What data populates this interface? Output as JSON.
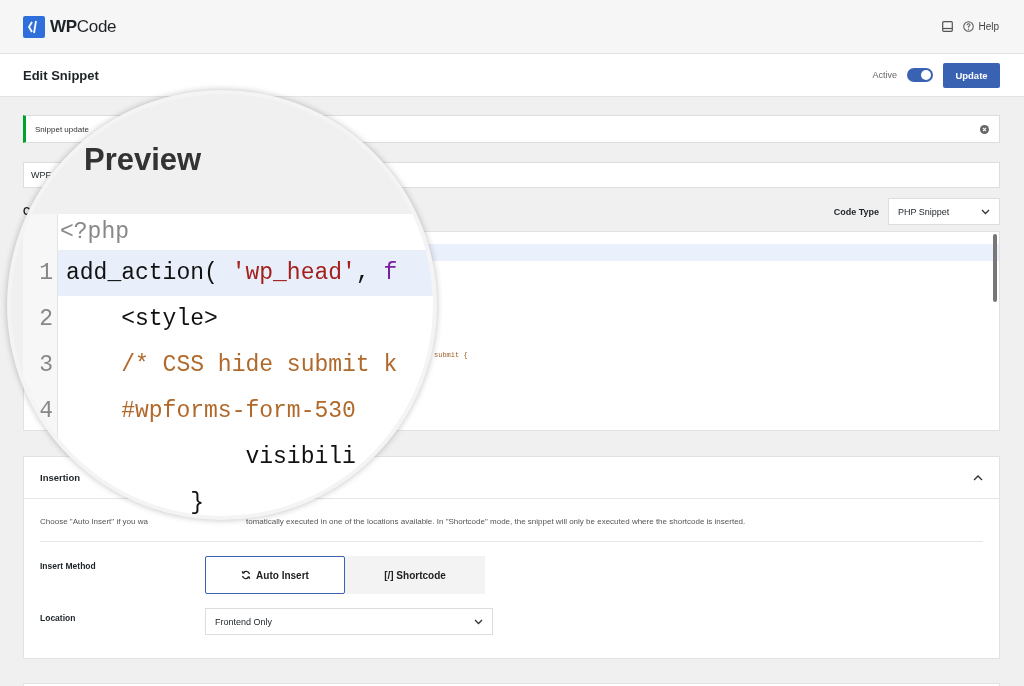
{
  "header": {
    "logo": "**WP**Code",
    "help": "Help"
  },
  "title_bar": {
    "title": "Edit Snippet",
    "active_label": "Active",
    "active_on": true,
    "update": "Update"
  },
  "notice": {
    "text": "Snippet update"
  },
  "snippet_title": {
    "value": "WPF"
  },
  "code": {
    "label": "C",
    "code_type_label": "Code Type",
    "code_type": "PHP Snippet",
    "visible_text": "submit {"
  },
  "magnifier": {
    "heading": "Preview",
    "lines": [
      {
        "kind": "open-tag",
        "tokens": [
          {
            "kind": "tag",
            "text": "<?php"
          }
        ],
        "highlighted": false
      },
      {
        "number": "1",
        "kind": "code",
        "tokens": [
          {
            "kind": "plain",
            "text": "add_action( "
          },
          {
            "kind": "string",
            "text": "'wp_head'"
          },
          {
            "kind": "plain",
            "text": ", "
          },
          {
            "kind": "keyword",
            "text": "f"
          }
        ],
        "highlighted": true
      },
      {
        "number": "2",
        "kind": "code",
        "tokens": [
          {
            "kind": "plain",
            "text": "    <style>"
          }
        ],
        "highlighted": false
      },
      {
        "number": "3",
        "kind": "code",
        "tokens": [
          {
            "kind": "comment",
            "text": "    /* CSS hide submit k"
          }
        ],
        "highlighted": false
      },
      {
        "number": "4",
        "kind": "code",
        "tokens": [
          {
            "kind": "comment",
            "text": "    #wpforms-form-530"
          }
        ],
        "highlighted": false
      },
      {
        "kind": "code",
        "tokens": [
          {
            "kind": "plain",
            "text": "             visibili"
          }
        ],
        "highlighted": false
      },
      {
        "kind": "code",
        "tokens": [
          {
            "kind": "plain",
            "text": "         }"
          }
        ],
        "highlighted": false
      }
    ]
  },
  "insertion": {
    "title": "Insertion",
    "expanded": true,
    "description_start": "Choose \"Auto Insert\" if you wa",
    "description_end": "tomatically executed in one of the locations available. In \"Shortcode\" mode, the snippet will only be executed where the shortcode is inserted.",
    "method_label": "Insert Method",
    "methods": [
      {
        "label": "Auto Insert",
        "kind": "auto",
        "selected": true
      },
      {
        "label": "[/] Shortcode",
        "kind": "shortcode",
        "selected": false
      }
    ],
    "location_label": "Location",
    "location": "Frontend Only"
  }
}
